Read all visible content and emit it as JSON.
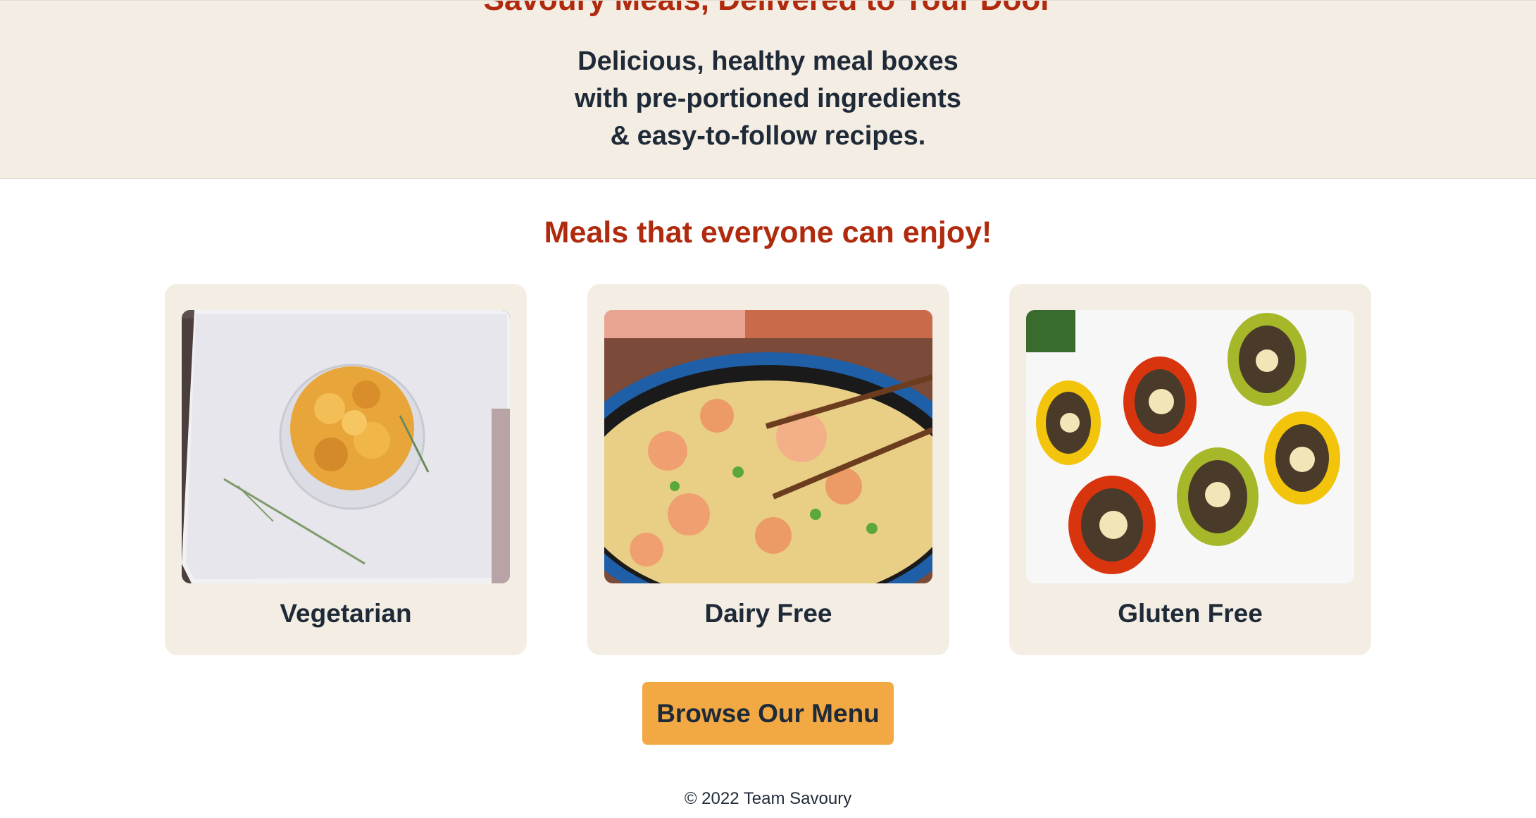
{
  "hero": {
    "title": "Savoury Meals, Delivered to Your Door",
    "tagline_lines": [
      "Delicious, healthy meal boxes",
      "with pre-portioned ingredients",
      "& easy-to-follow recipes."
    ]
  },
  "meals_section": {
    "title": "Meals that everyone can enjoy!",
    "cards": [
      {
        "label": "Vegetarian",
        "image": "mac-and-cheese-photo"
      },
      {
        "label": "Dairy Free",
        "image": "shrimp-fried-rice-photo"
      },
      {
        "label": "Gluten Free",
        "image": "stuffed-peppers-photo"
      }
    ]
  },
  "cta": {
    "label": "Browse Our Menu"
  },
  "footer": {
    "text": "© 2022 Team Savoury"
  },
  "colors": {
    "hero_bg": "#f3ede3",
    "accent_red": "#b02a0e",
    "button_orange": "#f2a944",
    "text_dark": "#1f2a38"
  }
}
